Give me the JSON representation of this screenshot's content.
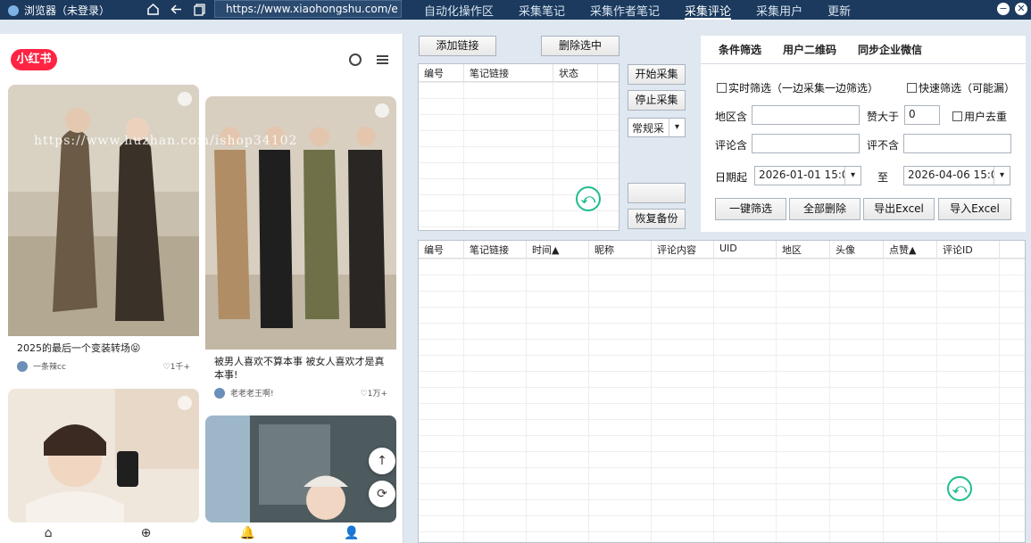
{
  "topbar": {
    "title": "浏览器（未登录）",
    "url": "https://www.xiaohongshu.com/e",
    "tabs": [
      "自动化操作区",
      "采集笔记",
      "采集作者笔记",
      "采集评论",
      "采集用户",
      "更新"
    ],
    "active_tab": "采集评论",
    "min_symbol": "−",
    "close_symbol": "✕"
  },
  "phone": {
    "logo": "小红书",
    "watermark": "https://www.huzhan.com/ishop34102",
    "cards": [
      {
        "caption": "2025的最后一个变装转场😝",
        "author": "一条辣cc",
        "likes": "♡1千+"
      },
      {
        "caption": "被男人喜欢不算本事 被女人喜欢才是真本事!",
        "author": "老老老王啊!",
        "likes": "♡1万+"
      },
      {
        "caption": "",
        "author": "",
        "likes": ""
      },
      {
        "caption": "",
        "author": "",
        "likes": ""
      }
    ],
    "fab_up": "↑",
    "fab_refresh": "⟳",
    "nav": [
      "⌂",
      "⊕",
      "🔔",
      "👤"
    ]
  },
  "links": {
    "add_button": "添加链接",
    "delete_selected_button": "删除选中",
    "columns": [
      "编号",
      "笔记链接",
      "状态"
    ],
    "start_button": "开始采集",
    "stop_button": "停止采集",
    "mode_select": "常规采",
    "blank_button": "",
    "restore_button": "恢复备份"
  },
  "filter": {
    "tabs": [
      "条件筛选",
      "用户二维码",
      "同步企业微信"
    ],
    "realtime_filter": "实时筛选（一边采集一边筛选）",
    "quick_filter": "快速筛选（可能漏）",
    "region_label": "地区含",
    "likes_gt_label": "赞大于",
    "likes_gt_value": "0",
    "dedupe_label": "用户去重",
    "comment_include_label": "评论含",
    "comment_exclude_label": "评不含",
    "date_from_label": "日期起",
    "date_from_value": "2026-01-01 15:0",
    "to_label": "至",
    "date_to_value": "2026-04-06 15:0",
    "one_click_filter_button": "一键筛选",
    "delete_all_button": "全部删除",
    "export_excel_button": "导出Excel",
    "import_excel_button": "导入Excel"
  },
  "results": {
    "columns": [
      "编号",
      "笔记链接",
      "时间▲",
      "昵称",
      "评论内容",
      "UID",
      "地区",
      "头像",
      "点赞▲",
      "评论ID"
    ]
  },
  "colors": {
    "accent": "#1fbd8f",
    "topbar": "#1b3a5e",
    "brand": "#ff2442"
  },
  "icons": [
    "home-icon",
    "back-icon",
    "copy-icon",
    "search-icon",
    "menu-icon",
    "return-icon"
  ]
}
